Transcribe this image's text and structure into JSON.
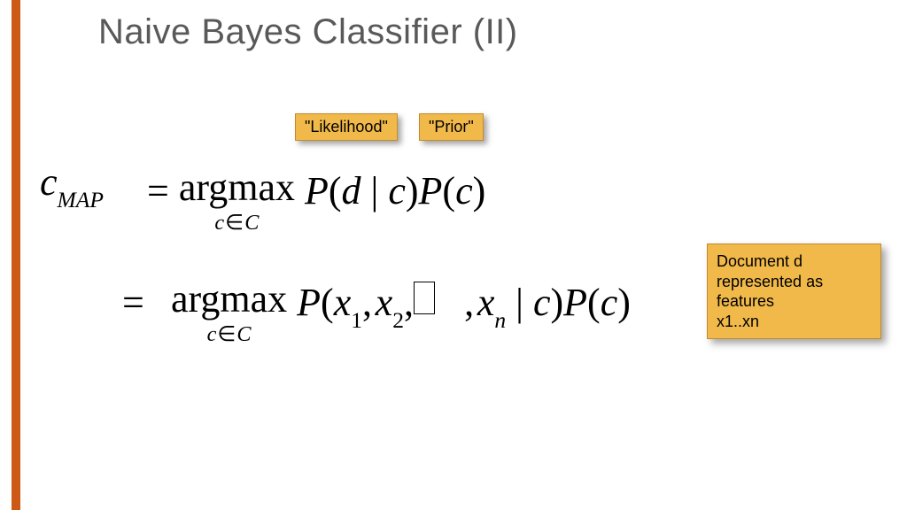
{
  "accent_color": "#cc5a16",
  "title": "Naive Bayes Classifier (II)",
  "tags": {
    "likelihood": "\"Likelihood\"",
    "prior": "\"Prior\""
  },
  "note_lines": {
    "l1": "Document d",
    "l2": "represented as",
    "l3": "features",
    "l4": "x1..xn"
  },
  "eq": {
    "c": "c",
    "map_sub": "MAP",
    "equals": "=",
    "argmax": "argmax",
    "cinC_c": "c",
    "cinC_in": "∈",
    "cinC_C": "C",
    "P": "P",
    "d": "d",
    "bar": "|",
    "x": "x",
    "n": "n",
    "comma": ",",
    "one": "1",
    "two": "2",
    "lp": "(",
    "rp": ")"
  }
}
